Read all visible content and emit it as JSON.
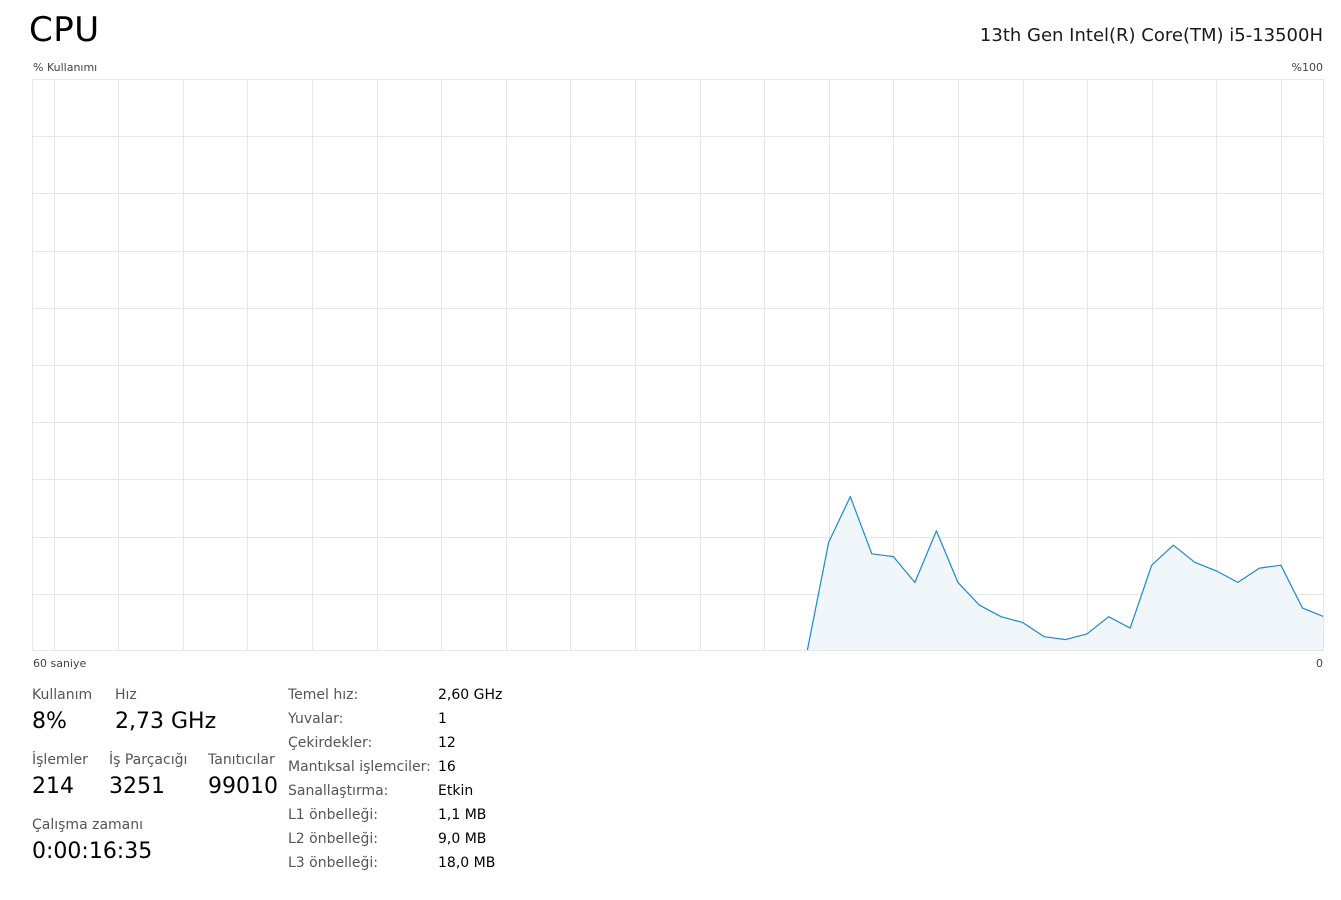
{
  "header": {
    "title": "CPU",
    "cpu_model": "13th Gen Intel(R) Core(TM) i5-13500H"
  },
  "graph": {
    "y_label": "% Kullanımı",
    "y_max_label": "%100",
    "x_left_label": "60 saniye",
    "x_right_label": "0",
    "line_color": "#1a8ad4",
    "fill_color": "#f1f6fb",
    "grid_color": "#e6e6e6"
  },
  "chart_data": {
    "type": "area",
    "title": "",
    "xlabel": "",
    "ylabel": "% Kullanımı",
    "xlim": [
      60,
      0
    ],
    "ylim": [
      0,
      100
    ],
    "grid": true,
    "series": [
      {
        "x": [
          24,
          23,
          22,
          21,
          20,
          19,
          18,
          17,
          16,
          15,
          14,
          13,
          12,
          11,
          10,
          9,
          8,
          7,
          6,
          5,
          4,
          3,
          2,
          1,
          0
        ],
        "values": [
          0,
          19,
          27,
          17,
          16.5,
          12,
          21,
          12,
          8,
          6,
          5,
          2.5,
          2,
          3,
          6,
          4,
          15,
          18.5,
          15.5,
          14,
          12,
          14.5,
          15,
          7.5,
          6
        ]
      }
    ]
  },
  "stats": {
    "usage_label": "Kullanım",
    "usage_value": "8%",
    "speed_label": "Hız",
    "speed_value": "2,73 GHz",
    "processes_label": "İşlemler",
    "processes_value": "214",
    "threads_label": "İş Parçacığı",
    "threads_value": "3251",
    "handles_label": "Tanıtıcılar",
    "handles_value": "99010",
    "uptime_label": "Çalışma zamanı",
    "uptime_value": "0:00:16:35"
  },
  "specs": [
    {
      "key": "Temel hız:",
      "value": "2,60 GHz"
    },
    {
      "key": "Yuvalar:",
      "value": "1"
    },
    {
      "key": "Çekirdekler:",
      "value": "12"
    },
    {
      "key": "Mantıksal işlemciler:",
      "value": "16"
    },
    {
      "key": "Sanallaştırma:",
      "value": "Etkin"
    },
    {
      "key": "L1 önbelleği:",
      "value": "1,1 MB"
    },
    {
      "key": "L2 önbelleği:",
      "value": "9,0 MB"
    },
    {
      "key": "L3 önbelleği:",
      "value": "18,0 MB"
    }
  ]
}
